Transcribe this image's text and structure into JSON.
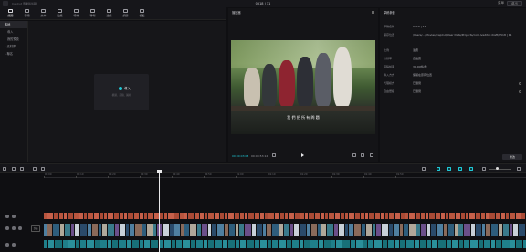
{
  "titlebar": {
    "app_name": "CapCut 專業版剪輯",
    "project_name": "0518 | 11",
    "export_label": "導出",
    "menu_label": "菜單"
  },
  "media_tools": [
    {
      "label": "媒體",
      "icon": "media-icon",
      "active": true
    },
    {
      "label": "音頻",
      "icon": "audio-icon"
    },
    {
      "label": "文本",
      "icon": "text-icon"
    },
    {
      "label": "貼紙",
      "icon": "sticker-icon"
    },
    {
      "label": "特效",
      "icon": "effects-icon"
    },
    {
      "label": "轉場",
      "icon": "transition-icon"
    },
    {
      "label": "濾鏡",
      "icon": "filter-icon"
    },
    {
      "label": "調節",
      "icon": "adjust-icon"
    },
    {
      "label": "模板",
      "icon": "template-icon"
    }
  ],
  "sidebar": {
    "items": [
      {
        "label": "本地",
        "active": true
      },
      {
        "label": "導入",
        "sub": true
      },
      {
        "label": "我的預設",
        "sub": true
      },
      {
        "label": "▸ 素材庫"
      },
      {
        "label": "▸ 聯名"
      }
    ]
  },
  "media": {
    "import_label": "導入",
    "import_hint": "視頻、音頻、圖片"
  },
  "player": {
    "title": "播放器",
    "caption": "我 們 把 所 有 問 題",
    "current_time": "00:00:03:08",
    "total_time": "00:00:53:12"
  },
  "details": {
    "title": "草稿參數",
    "rows": [
      {
        "label": "草稿名稱",
        "value": "0518 | 11"
      },
      {
        "label": "保存位置",
        "value": "/Users/.../Movies/CapCut/User Data/Projects/com.lveditor.draft/0518 | 11"
      },
      {
        "label": "比例",
        "value": "適應"
      },
      {
        "label": "分辨率",
        "value": "自適應"
      },
      {
        "label": "草稿幀率",
        "value": "30.00幀/秒"
      },
      {
        "label": "導入方式",
        "value": "保留在原有位置"
      },
      {
        "label": "代理模式",
        "value": "已關閉"
      },
      {
        "label": "自由層級",
        "value": "已關閉"
      }
    ],
    "modify_label": "修改"
  },
  "timeline": {
    "ruler_ticks": [
      "00:00",
      "00:10",
      "00:20",
      "00:30",
      "00:40",
      "00:50",
      "01:00",
      "01:10",
      "01:20",
      "01:30",
      "01:40",
      "01:50"
    ],
    "cover_label": "封面"
  }
}
